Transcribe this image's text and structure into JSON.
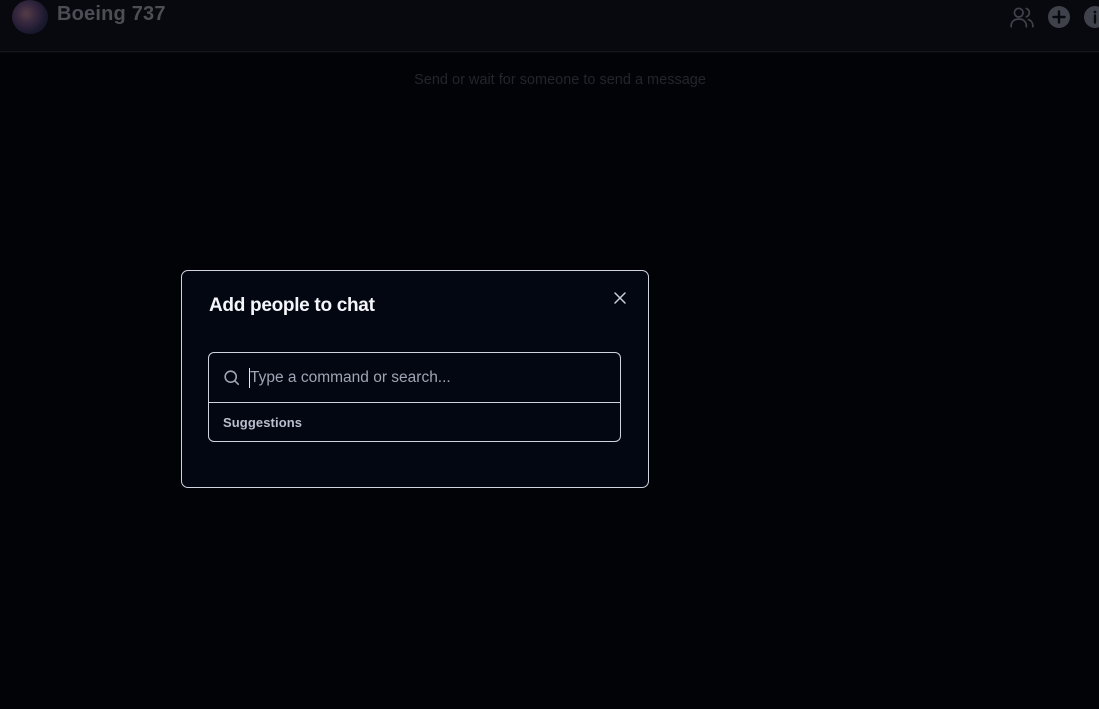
{
  "header": {
    "chat_title": "Boeing 737",
    "icons": [
      "users-icon",
      "plus-circle-icon",
      "info-icon"
    ]
  },
  "main": {
    "empty_message": "Send or wait for someone to send a message"
  },
  "dialog": {
    "title": "Add people to chat",
    "search": {
      "placeholder": "Type a command or search...",
      "value": ""
    },
    "group_heading": "Suggestions"
  },
  "colors": {
    "background": "#08090e",
    "dialog_bg": "#030712",
    "border": "#cfd3de",
    "title_text": "#f4f6fb",
    "placeholder_text": "#9fa5b4"
  }
}
